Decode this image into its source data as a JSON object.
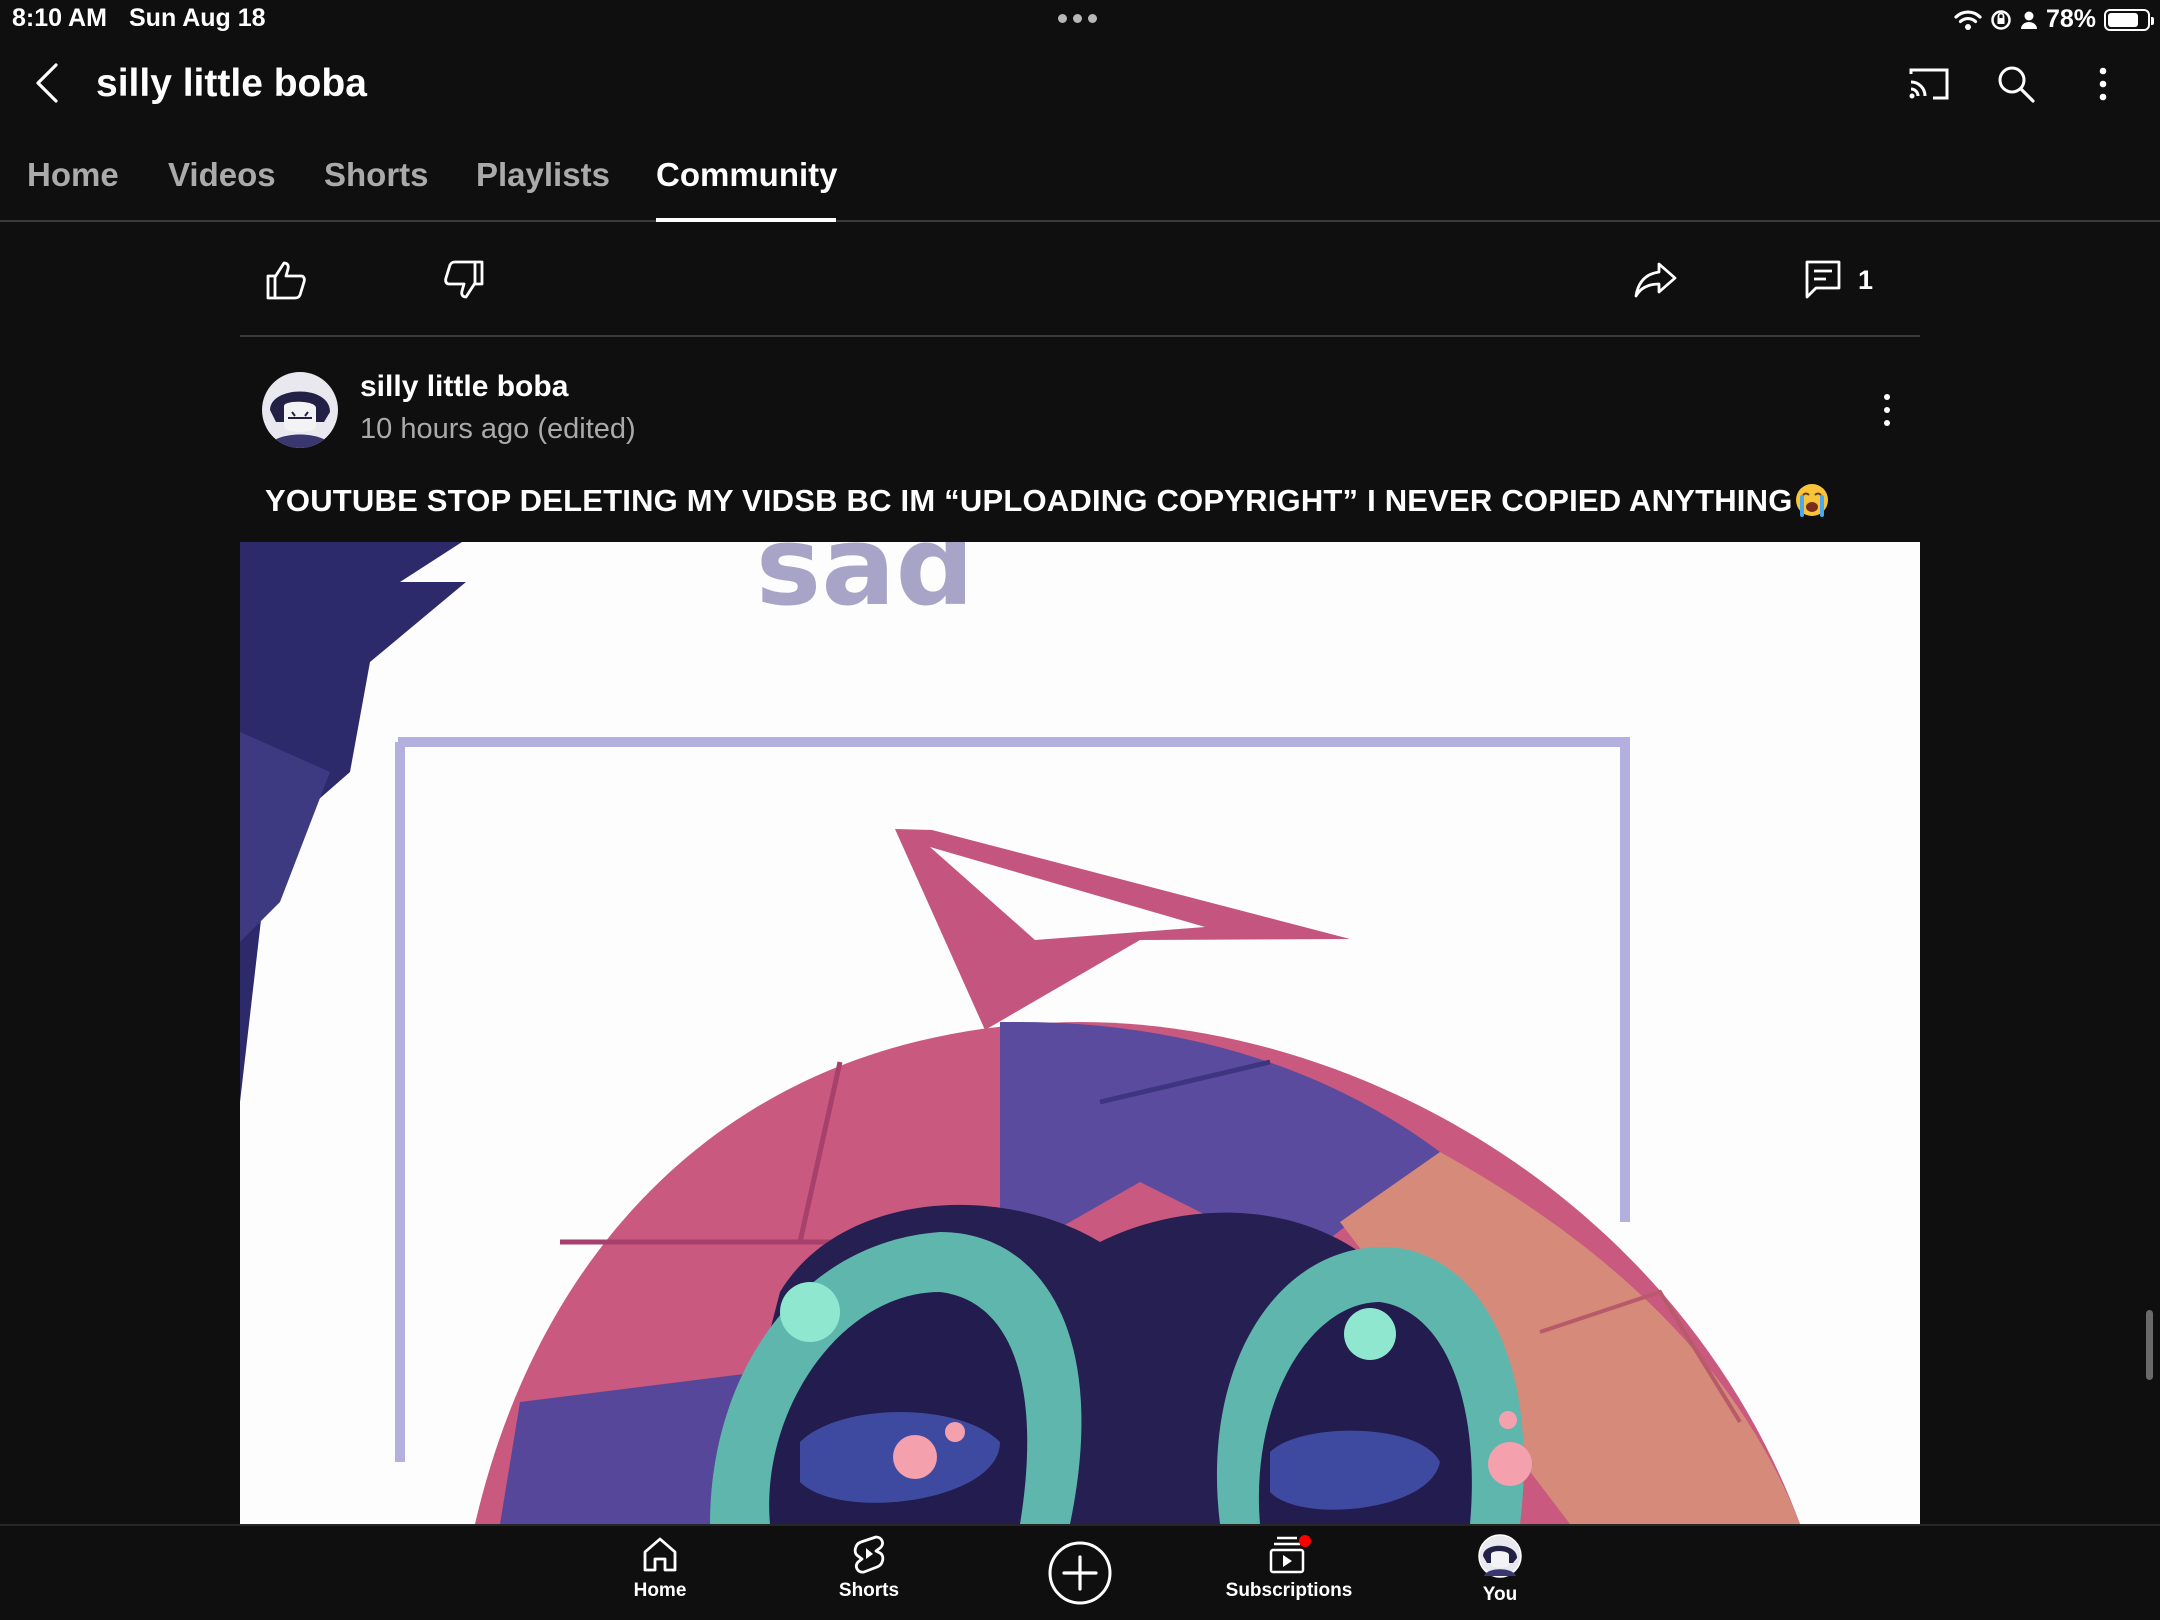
{
  "status_bar": {
    "time": "8:10 AM",
    "date": "Sun Aug 18",
    "battery_text": "78%",
    "battery_level": 0.78,
    "icons": [
      "wifi-icon",
      "screen-lock-rotation-icon",
      "person-icon",
      "battery-icon"
    ]
  },
  "header": {
    "channel_title": "silly little boba",
    "icons": [
      "back-arrow-icon",
      "cast-icon",
      "search-icon",
      "more-vertical-icon"
    ]
  },
  "tabs": [
    {
      "label": "Home",
      "active": false
    },
    {
      "label": "Videos",
      "active": false
    },
    {
      "label": "Shorts",
      "active": false
    },
    {
      "label": "Playlists",
      "active": false
    },
    {
      "label": "Community",
      "active": true
    }
  ],
  "action_row": {
    "icons": [
      "thumbs-up-icon",
      "thumbs-down-icon",
      "share-icon",
      "comment-icon"
    ],
    "comments_count": "1"
  },
  "post": {
    "author": "silly little boba",
    "time": "10 hours ago (edited)",
    "text": "YOUTUBE STOP DELETING MY VIDSB BC IM “UPLOADING COPYRIGHT” I NEVER COPIED ANYTHING",
    "emoji": "loudly-crying-face",
    "image_caption": "sad"
  },
  "bottom_nav": {
    "home": "Home",
    "shorts": "Shorts",
    "subscriptions": "Subscriptions",
    "you": "You",
    "subscriptions_badge_color": "#ff0000"
  },
  "colors": {
    "background": "#0f0f0f",
    "text_primary": "#f1f1f1",
    "text_secondary": "#aaaaaa",
    "divider": "#3a3a3a"
  }
}
